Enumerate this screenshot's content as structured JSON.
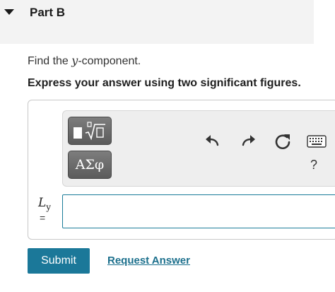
{
  "part": {
    "title": "Part B"
  },
  "question": {
    "prompt_before": "Find the ",
    "prompt_variable": "y",
    "prompt_after": "-component.",
    "instruction": "Express your answer using two significant figures."
  },
  "toolbar": {
    "symbols_label": "ΑΣφ",
    "help_label": "?"
  },
  "answer": {
    "variable_main": "L",
    "variable_sub": "y",
    "equals": "=",
    "value": "",
    "placeholder": ""
  },
  "actions": {
    "submit_label": "Submit",
    "request_answer_label": "Request Answer"
  },
  "colors": {
    "accent": "#1b7899",
    "link": "#1b6f8c",
    "header_bg": "#f3f3f3"
  }
}
